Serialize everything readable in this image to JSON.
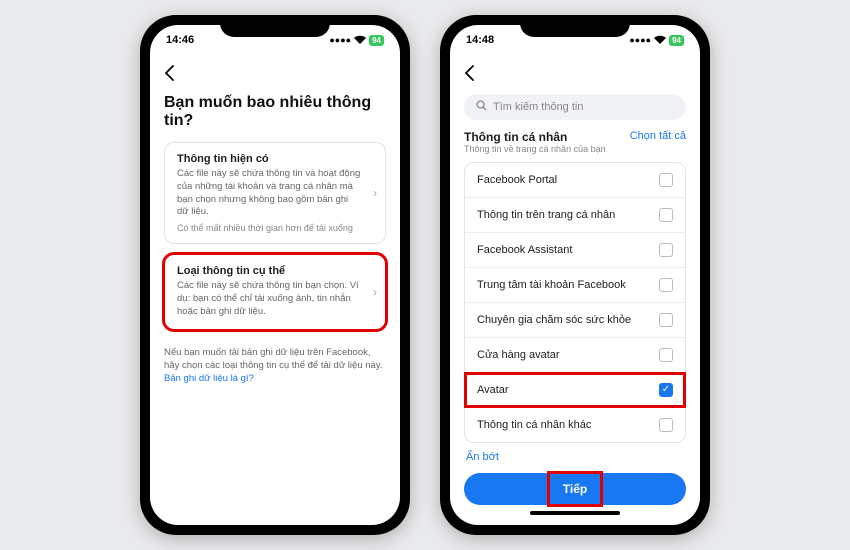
{
  "left": {
    "status": {
      "time": "14:46",
      "battery": "94"
    },
    "page_title": "Bạn muốn bao nhiêu thông tin?",
    "option1": {
      "title": "Thông tin hiện có",
      "desc": "Các file này sẽ chứa thông tin và hoạt động của những tài khoản và trang cá nhân mà bạn chọn nhưng không bao gồm bản ghi dữ liệu.",
      "sub": "Có thể mất nhiều thời gian hơn đế tải xuống"
    },
    "option2": {
      "title": "Loại thông tin cụ thể",
      "desc": "Các file này sẽ chứa thông tin bạn chọn. Ví dụ: bạn có thể chỉ tải xuống ảnh, tin nhắn hoặc bản ghi dữ liệu."
    },
    "note": "Nếu bạn muốn tải bản ghi dữ liệu trên Facebook, hãy chọn các loại thông tin cụ thể để tải dữ liệu này.",
    "note_link": "Bản ghi dữ liệu là gì?"
  },
  "right": {
    "status": {
      "time": "14:48",
      "battery": "94"
    },
    "search_placeholder": "Tìm kiếm thông tin",
    "section_title": "Thông tin cá nhân",
    "section_sub": "Thông tin về trang cá nhân của bạn",
    "select_all": "Chọn tất cả",
    "items": [
      {
        "label": "Facebook Portal",
        "checked": false
      },
      {
        "label": "Thông tin trên trang cá nhân",
        "checked": false
      },
      {
        "label": "Facebook Assistant",
        "checked": false
      },
      {
        "label": "Trung tâm tài khoản Facebook",
        "checked": false
      },
      {
        "label": "Chuyên gia chăm sóc sức khỏe",
        "checked": false
      },
      {
        "label": "Cửa hàng avatar",
        "checked": false
      },
      {
        "label": "Avatar",
        "checked": true
      },
      {
        "label": "Thông tin cá nhân khác",
        "checked": false
      }
    ],
    "hide_less": "Ẩn bớt",
    "continue": "Tiếp"
  }
}
